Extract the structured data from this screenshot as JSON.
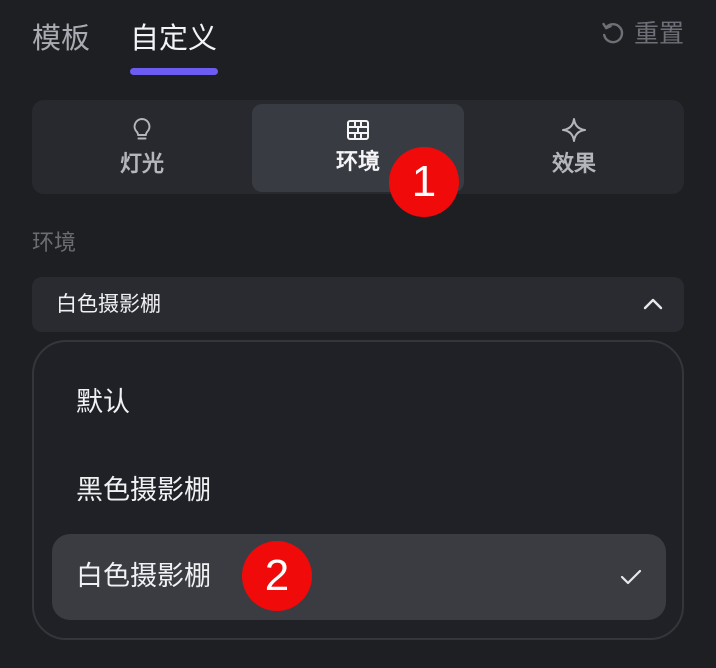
{
  "top_tabs": [
    {
      "label": "模板",
      "active": false
    },
    {
      "label": "自定义",
      "active": true
    }
  ],
  "reset_label": "重置",
  "segments": [
    {
      "label": "灯光",
      "icon": "bulb-icon",
      "active": false
    },
    {
      "label": "环境",
      "icon": "brick-wall-icon",
      "active": true
    },
    {
      "label": "效果",
      "icon": "sparkle-icon",
      "active": false
    }
  ],
  "section_label": "环境",
  "select": {
    "value": "白色摄影棚"
  },
  "options": [
    {
      "label": "默认",
      "selected": false
    },
    {
      "label": "黑色摄影棚",
      "selected": false
    },
    {
      "label": "白色摄影棚",
      "selected": true
    }
  ],
  "annotations": [
    "1",
    "2"
  ],
  "colors": {
    "background": "#1e1f23",
    "accent": "#6c5cf2",
    "badge": "#f00a0a",
    "selected_option": "#3a3c42"
  }
}
